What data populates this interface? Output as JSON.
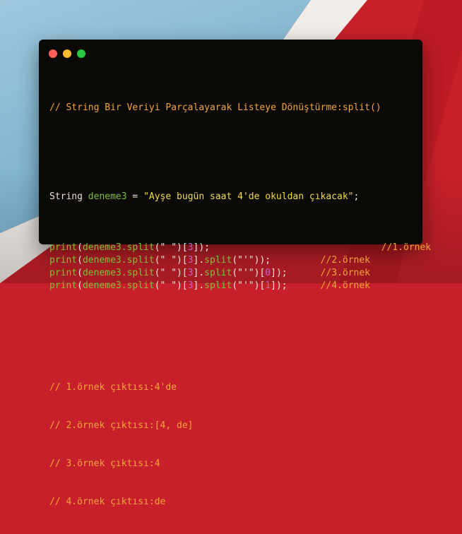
{
  "window": {
    "controls": [
      "close",
      "minimize",
      "maximize"
    ]
  },
  "code": {
    "header_comment": "// String Bir Veriyi Parçalayarak Listeye Dönüştürme:split()",
    "decl": {
      "type": "String ",
      "var": "deneme3",
      "op": " = ",
      "value": "\"Ayşe bugün saat 4'de okuldan çıkacak\"",
      "end": ";"
    },
    "prints": [
      {
        "fn": "print",
        "open": "(",
        "expr1": "deneme3.split",
        "p1": "(\" \")[",
        "i1": "3",
        "p2": "]",
        "expr2": "",
        "p3": "",
        "i2": "",
        "p4": "",
        "close": ");",
        "pad": "                               ",
        "comment": "//1.örnek"
      },
      {
        "fn": "print",
        "open": "(",
        "expr1": "deneme3.split",
        "p1": "(\" \")[",
        "i1": "3",
        "p2": "].",
        "expr2": "split",
        "p3": "(\"'\")",
        "i2": "",
        "p4": "",
        "close": ");",
        "pad": "         ",
        "comment": "//2.örnek"
      },
      {
        "fn": "print",
        "open": "(",
        "expr1": "deneme3.split",
        "p1": "(\" \")[",
        "i1": "3",
        "p2": "].",
        "expr2": "split",
        "p3": "(\"'\")[",
        "i2": "0",
        "p4": "]",
        "close": ");",
        "pad": "      ",
        "comment": "//3.örnek"
      },
      {
        "fn": "print",
        "open": "(",
        "expr1": "deneme3.split",
        "p1": "(\" \")[",
        "i1": "3",
        "p2": "].",
        "expr2": "split",
        "p3": "(\"'\")[",
        "i2": "1",
        "p4": "]",
        "close": ");",
        "pad": "      ",
        "comment": "//4.örnek"
      }
    ],
    "outputs": [
      "// 1.örnek çıktısı:4'de",
      "// 2.örnek çıktısı:[4, de]",
      "// 3.örnek çıktısı:4",
      "// 4.örnek çıktısı:de"
    ]
  }
}
